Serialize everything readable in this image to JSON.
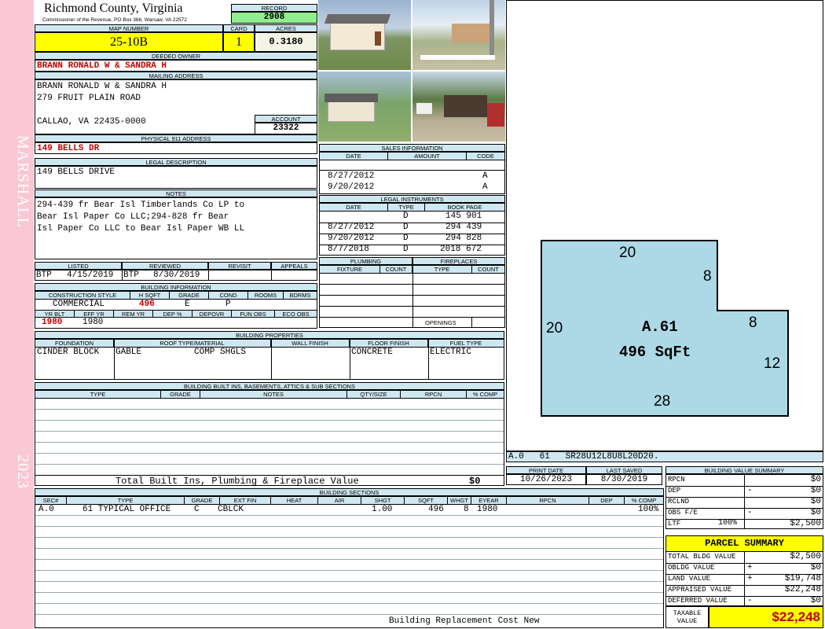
{
  "sidebar": {
    "district": "MARSHALL",
    "year": "2023"
  },
  "header": {
    "county": "Richmond County, Virginia",
    "commissioner": "Commissioner of the Revenue, PO Box 366, Warsaw, VA 22572",
    "record_label": "RECORD",
    "record": "2908",
    "map_label": "MAP NUMBER",
    "map": "25-10B",
    "card_label": "CARD",
    "card": "1",
    "acres_label": "ACRES",
    "acres": "0.3180"
  },
  "owner": {
    "deeded_label": "DEEDED OWNER",
    "deeded": "BRANN RONALD W & SANDRA H",
    "mailing_label": "MAILING ADDRESS",
    "mailing": [
      "BRANN RONALD W & SANDRA H",
      "279 FRUIT PLAIN ROAD",
      "",
      "CALLAO, VA 22435-0000"
    ],
    "account_label": "ACCOUNT",
    "account": "23322",
    "physical_label": "PHYSICAL 911 ADDRESS",
    "physical": "149 BELLS DR",
    "legal_label": "LEGAL DESCRIPTION",
    "legal": "149 BELLS DRIVE",
    "notes_label": "NOTES",
    "notes": [
      "294-439 fr Bear Isl Timberlands Co LP to",
      "Bear Isl Paper Co LLC;294-828 fr Bear",
      "Isl Paper Co LLC to Bear Isl Paper WB LL"
    ]
  },
  "review": {
    "headers": [
      "LISTED",
      "REVIEWED",
      "REVISIT",
      "APPEALS"
    ],
    "listed_by": "BTP",
    "listed": "4/15/2019",
    "reviewed_by": "BTP",
    "reviewed": "8/30/2019"
  },
  "building_info": {
    "title": "BUILDING INFORMATION",
    "headers": [
      "CONSTRUCTION STYLE",
      "H SQFT",
      "GRADE",
      "COND",
      "ROOMS",
      "BDRMS"
    ],
    "style": "COMMERCIAL",
    "hsqft": "496",
    "grade": "E",
    "cond": "P",
    "headers2": [
      "YR BLT",
      "EFF YR",
      "REM YR",
      "DEP %",
      "DEPOVR",
      "FUN OBS",
      "ECO OBS"
    ],
    "yrblt": "1980",
    "effyr": "1980"
  },
  "sales": {
    "title": "SALES INFORMATION",
    "headers": [
      "DATE",
      "AMOUNT",
      "CODE"
    ],
    "rows": [
      {
        "date": "8/27/2012",
        "code": "A"
      },
      {
        "date": "9/20/2012",
        "code": "A"
      }
    ]
  },
  "legal_instruments": {
    "title": "LEGAL INSTRUMENTS",
    "headers": [
      "DATE",
      "TYPE",
      "BOOK PAGE"
    ],
    "rows": [
      {
        "date": "",
        "type": "D",
        "book": "145 901"
      },
      {
        "date": "8/27/2012",
        "type": "D",
        "book": "294 439"
      },
      {
        "date": "9/20/2012",
        "type": "D",
        "book": "294 828"
      },
      {
        "date": "8/7/2018",
        "type": "D",
        "book": "2018 672"
      }
    ]
  },
  "plumbing": {
    "title": "PLUMBING",
    "headers": [
      "FIXTURE",
      "COUNT"
    ]
  },
  "fireplaces": {
    "title": "FIREPLACES",
    "headers": [
      "TYPE",
      "COUNT"
    ],
    "openings": "OPENINGS"
  },
  "properties": {
    "title": "BUILDING PROPERTIES",
    "headers": [
      "FOUNDATION",
      "ROOF TYPE/MATERIAL",
      "WALL FINISH",
      "FLOOR FINISH",
      "FUEL TYPE"
    ],
    "foundation": "CINDER BLOCK",
    "roof_type": "GABLE",
    "roof_mat": "COMP SHGLS",
    "floor": "CONCRETE",
    "fuel": "ELECTRIC"
  },
  "builtins": {
    "title": "BUILDING BUILT INS, BASEMENTS, ATTICS & SUB SECTIONS",
    "headers": [
      "TYPE",
      "GRADE",
      "NOTES",
      "QTY/SIZE",
      "RPCN",
      "% COMP"
    ],
    "total_label": "Total Built Ins, Plumbing & Fireplace Value",
    "total": "$0"
  },
  "sketch": {
    "dims": [
      "20",
      "8",
      "8",
      "20",
      "12",
      "28"
    ],
    "section": "A.61",
    "area": "496 SqFt",
    "code": "A.0   61   SR28U12L8U8L20D20."
  },
  "dates": {
    "print_label": "PRINT DATE",
    "print": "10/26/2023",
    "saved_label": "LAST SAVED",
    "saved": "8/30/2019"
  },
  "sections": {
    "title": "BUILDING SECTIONS",
    "headers": [
      "SEC#",
      "TYPE",
      "GRADE",
      "EXT FIN",
      "HEAT",
      "AIR",
      "SHGT",
      "SQFT",
      "WHGT",
      "EYEAR",
      "RPCN",
      "DEP",
      "% COMP"
    ],
    "row": {
      "sec": "A.0",
      "type": "61 TYPICAL OFFICE",
      "grade": "C",
      "ext": "CBLCK",
      "shgt": "1.00",
      "sqft": "496",
      "whgt": "8",
      "eyear": "1980",
      "comp": "100%"
    },
    "footer": "Building Replacement Cost New"
  },
  "value_summary": {
    "title": "BUILDING VALUE SUMMARY",
    "rows": [
      {
        "label": "RPCN",
        "sign": "",
        "value": "$0"
      },
      {
        "label": "DEP",
        "sign": "-",
        "value": "$0"
      },
      {
        "label": "RCLND",
        "sign": "",
        "value": "$0"
      },
      {
        "label": "OBS F/E",
        "sign": "-",
        "value": "$0"
      },
      {
        "label": "LTF",
        "pct": "100%",
        "sign": "",
        "value": "$2,500"
      }
    ]
  },
  "parcel": {
    "title": "PARCEL SUMMARY",
    "rows": [
      {
        "label": "TOTAL BLDG VALUE",
        "sign": "",
        "value": "$2,500"
      },
      {
        "label": "OBLDG VALUE",
        "sign": "+",
        "value": "$0"
      },
      {
        "label": "LAND VALUE",
        "sign": "+",
        "value": "$19,748"
      },
      {
        "label": "APPRAISED VALUE",
        "sign": "",
        "value": "$22,248"
      },
      {
        "label": "DEFERRED VALUE",
        "sign": "-",
        "value": "$0"
      }
    ],
    "taxable_label": "TAXABLE VALUE",
    "taxable": "$22,248"
  }
}
